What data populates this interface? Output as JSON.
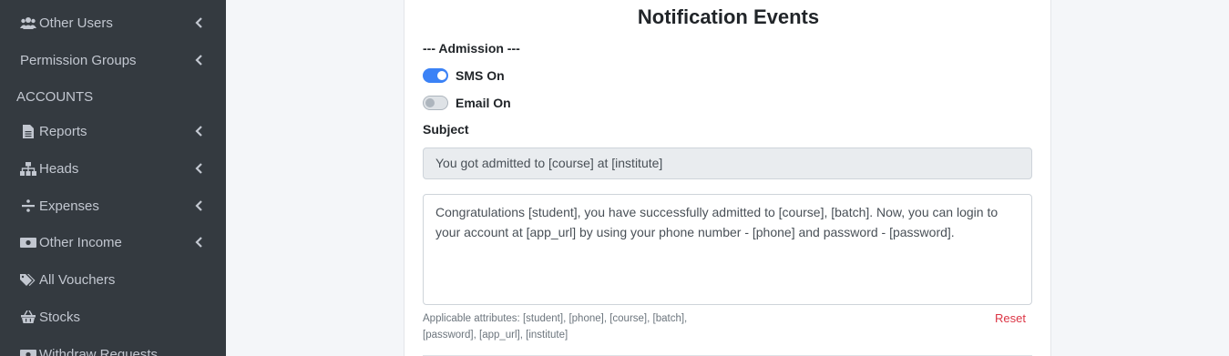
{
  "sidebar": {
    "items": [
      {
        "label": "Other Users",
        "icon": "users-icon"
      },
      {
        "label": "Permission Groups",
        "icon": ""
      },
      {
        "label": "Reports",
        "icon": "file-icon"
      },
      {
        "label": "Heads",
        "icon": "sitemap-icon"
      },
      {
        "label": "Expenses",
        "icon": "divide-icon"
      },
      {
        "label": "Other Income",
        "icon": "money-icon"
      },
      {
        "label": "All Vouchers",
        "icon": "tags-icon"
      },
      {
        "label": "Stocks",
        "icon": "basket-icon"
      },
      {
        "label": "Withdraw Requests",
        "icon": "money-icon"
      }
    ],
    "header": "ACCOUNTS"
  },
  "card": {
    "title": "Notification Events",
    "section": "--- Admission ---",
    "sms_label": "SMS On",
    "sms_on": true,
    "email_label": "Email On",
    "email_on": false,
    "subject_label": "Subject",
    "subject_value": "You got admitted to [course] at [institute]",
    "message_value": "Congratulations [student], you have successfully admitted to [course], [batch]. Now, you can login to your account at [app_url] by using your phone number - [phone] and password - [password].",
    "help_text": "Applicable attributes: [student], [phone], [course], [batch], [password], [app_url], [institute]",
    "reset_label": "Reset"
  },
  "colors": {
    "sidebar_bg": "#343a40",
    "accent": "#3b82f6",
    "danger": "#dc3545"
  }
}
